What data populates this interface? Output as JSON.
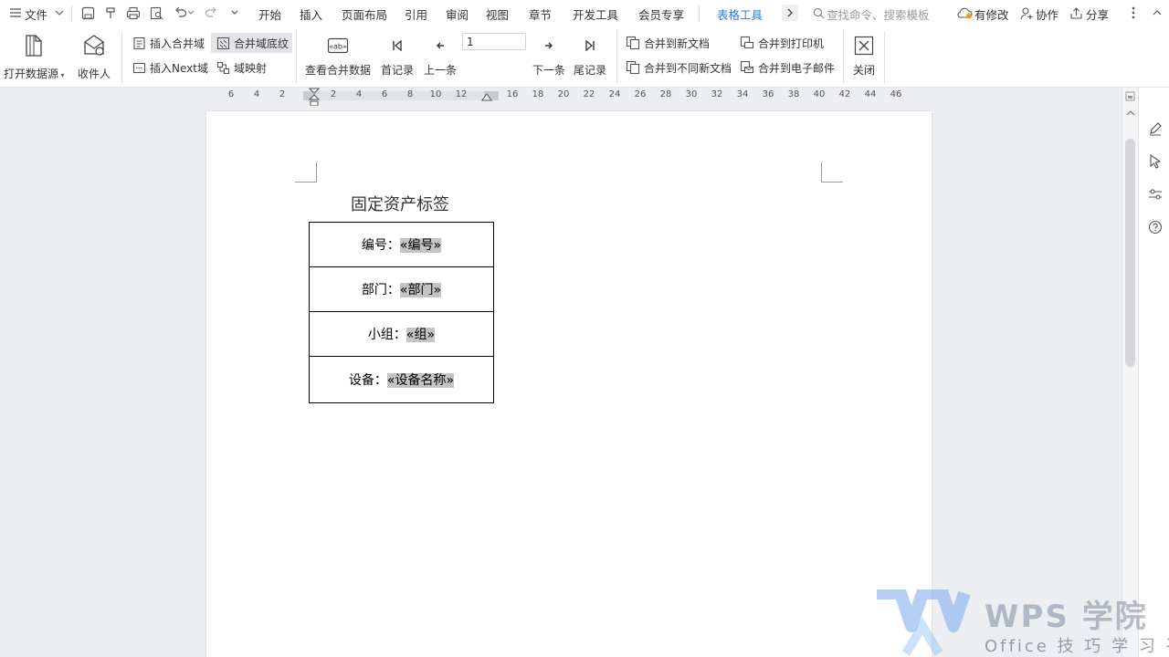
{
  "menubar": {
    "file": "文件",
    "tabs": [
      {
        "label": "开始"
      },
      {
        "label": "插入"
      },
      {
        "label": "页面布局"
      },
      {
        "label": "引用"
      },
      {
        "label": "审阅"
      },
      {
        "label": "视图"
      },
      {
        "label": "章节"
      },
      {
        "label": "开发工具"
      },
      {
        "label": "会员专享"
      },
      {
        "label": "表格工具"
      }
    ],
    "search_placeholder": "查找命令、搜索模板",
    "modified": "有修改",
    "collaborate": "协作",
    "share": "分享"
  },
  "ribbon": {
    "open_source": "打开数据源",
    "recipients": "收件人",
    "insert_merge_field": "插入合并域",
    "merge_field_shading": "合并域底纹",
    "insert_next": "插入Next域",
    "field_mapping": "域映射",
    "view_merged_data": "查看合并数据",
    "first_record": "首记录",
    "prev_record": "上一条",
    "record_number": "1",
    "next_record": "下一条",
    "last_record": "尾记录",
    "merge_new_doc": "合并到新文档",
    "merge_diff_docs": "合并到不同新文档",
    "merge_printer": "合并到打印机",
    "merge_email": "合并到电子邮件",
    "close": "关闭"
  },
  "ruler": {
    "ticks": [
      "6",
      "4",
      "2",
      "",
      "2",
      "4",
      "6",
      "8",
      "10",
      "12",
      "",
      "16",
      "18",
      "20",
      "22",
      "24",
      "26",
      "28",
      "30",
      "32",
      "34",
      "36",
      "38",
      "40",
      "42",
      "44",
      "46"
    ]
  },
  "document": {
    "title": "固定资产标签",
    "rows": [
      {
        "label": "编号：",
        "field": "«编号»"
      },
      {
        "label": "部门：",
        "field": "«部门»"
      },
      {
        "label": "小组：",
        "field": "«组»"
      },
      {
        "label": "设备：",
        "field": "«设备名称»"
      }
    ]
  },
  "watermark": {
    "brand": "WPS 学院",
    "subtitle": "Office 技 巧 学 习 平 台"
  }
}
